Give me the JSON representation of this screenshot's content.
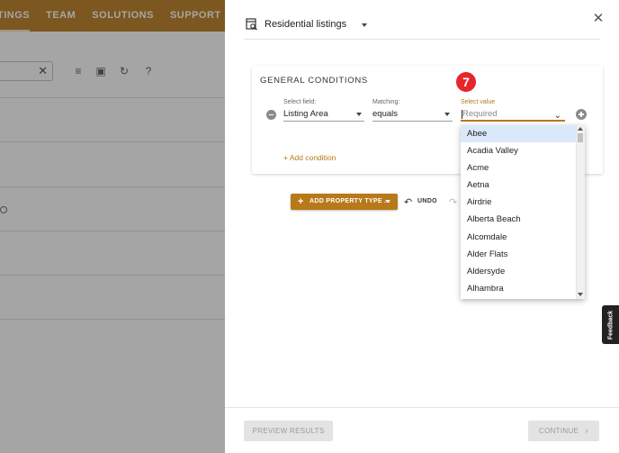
{
  "background_nav": {
    "items": [
      "TINGS",
      "TEAM",
      "SOLUTIONS",
      "SUPPORT"
    ]
  },
  "drawer": {
    "listing_type": "Residential listings",
    "close_glyph": "✕"
  },
  "conditions": {
    "title": "GENERAL CONDITIONS",
    "select_field_label": "Select field:",
    "select_field_value": "Listing Area",
    "matching_label": "Matching:",
    "matching_value": "equals",
    "select_value_label": "Select value",
    "select_value_placeholder": "Required",
    "add_condition": "+ Add condition"
  },
  "step_badge": "7",
  "dropdown_options": [
    "Abee",
    "Acadia Valley",
    "Acme",
    "Aetna",
    "Airdrie",
    "Alberta Beach",
    "Alcomdale",
    "Alder Flats",
    "Aldersyde",
    "Alhambra"
  ],
  "dropdown_selected": "Abee",
  "actions": {
    "add_property_type": "ADD PROPERTY TYPE ...",
    "undo": "UNDO"
  },
  "footer": {
    "preview": "PREVIEW RESULTS",
    "continue": "CONTINUE"
  },
  "feedback": "Feedback",
  "colors": {
    "accent": "#b8791a",
    "badge": "#e5262b",
    "highlight": "#dbe8fb"
  }
}
